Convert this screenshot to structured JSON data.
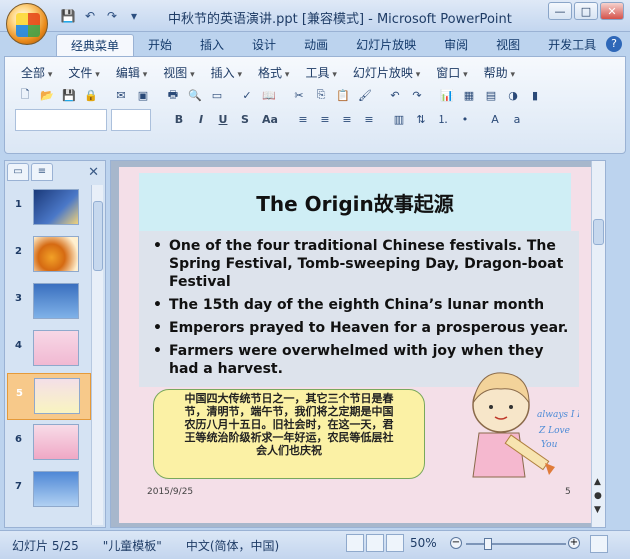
{
  "window": {
    "title": "中秋节的英语演讲.ppt [兼容模式] - Microsoft PowerPoint",
    "controls": [
      "—",
      "□",
      "✕"
    ]
  },
  "ribbon_tabs": [
    "经典菜单",
    "开始",
    "插入",
    "设计",
    "动画",
    "幻灯片放映",
    "审阅",
    "视图",
    "开发工具"
  ],
  "classic_menu": [
    "全部",
    "文件",
    "编辑",
    "视图",
    "插入",
    "格式",
    "工具",
    "幻灯片放映",
    "窗口",
    "帮助"
  ],
  "format_buttons": [
    "B",
    "I",
    "U",
    "S",
    "Aa"
  ],
  "slide": {
    "title": "The Origin故事起源",
    "bullets": [
      "One of the four traditional Chinese festivals. The Spring Festival, Tomb-sweeping Day, Dragon-boat Festival",
      "The 15th day of the eighth China’s lunar month",
      "Emperors prayed to Heaven for a prosperous year.",
      "Farmers were overwhelmed with joy when they had a harvest."
    ],
    "chinese_text": "中国四大传统节日之一，其它三个节日是春节，清明节，端午节，我们将之定期是中国农历八月十五日。旧社会时，在这一天，君王等统治阶级祈求一年好运，农民等低层社会人们也庆祝",
    "date": "2015/9/25",
    "page_number": "5",
    "image_text": "always I Love You"
  },
  "thumbnails": [
    "1",
    "2",
    "3",
    "4",
    "5",
    "6",
    "7"
  ],
  "status": {
    "slide_info": "幻灯片 5/25",
    "template": "\"儿童模板\"",
    "language": "中文(简体，中国)",
    "zoom": "50%"
  }
}
